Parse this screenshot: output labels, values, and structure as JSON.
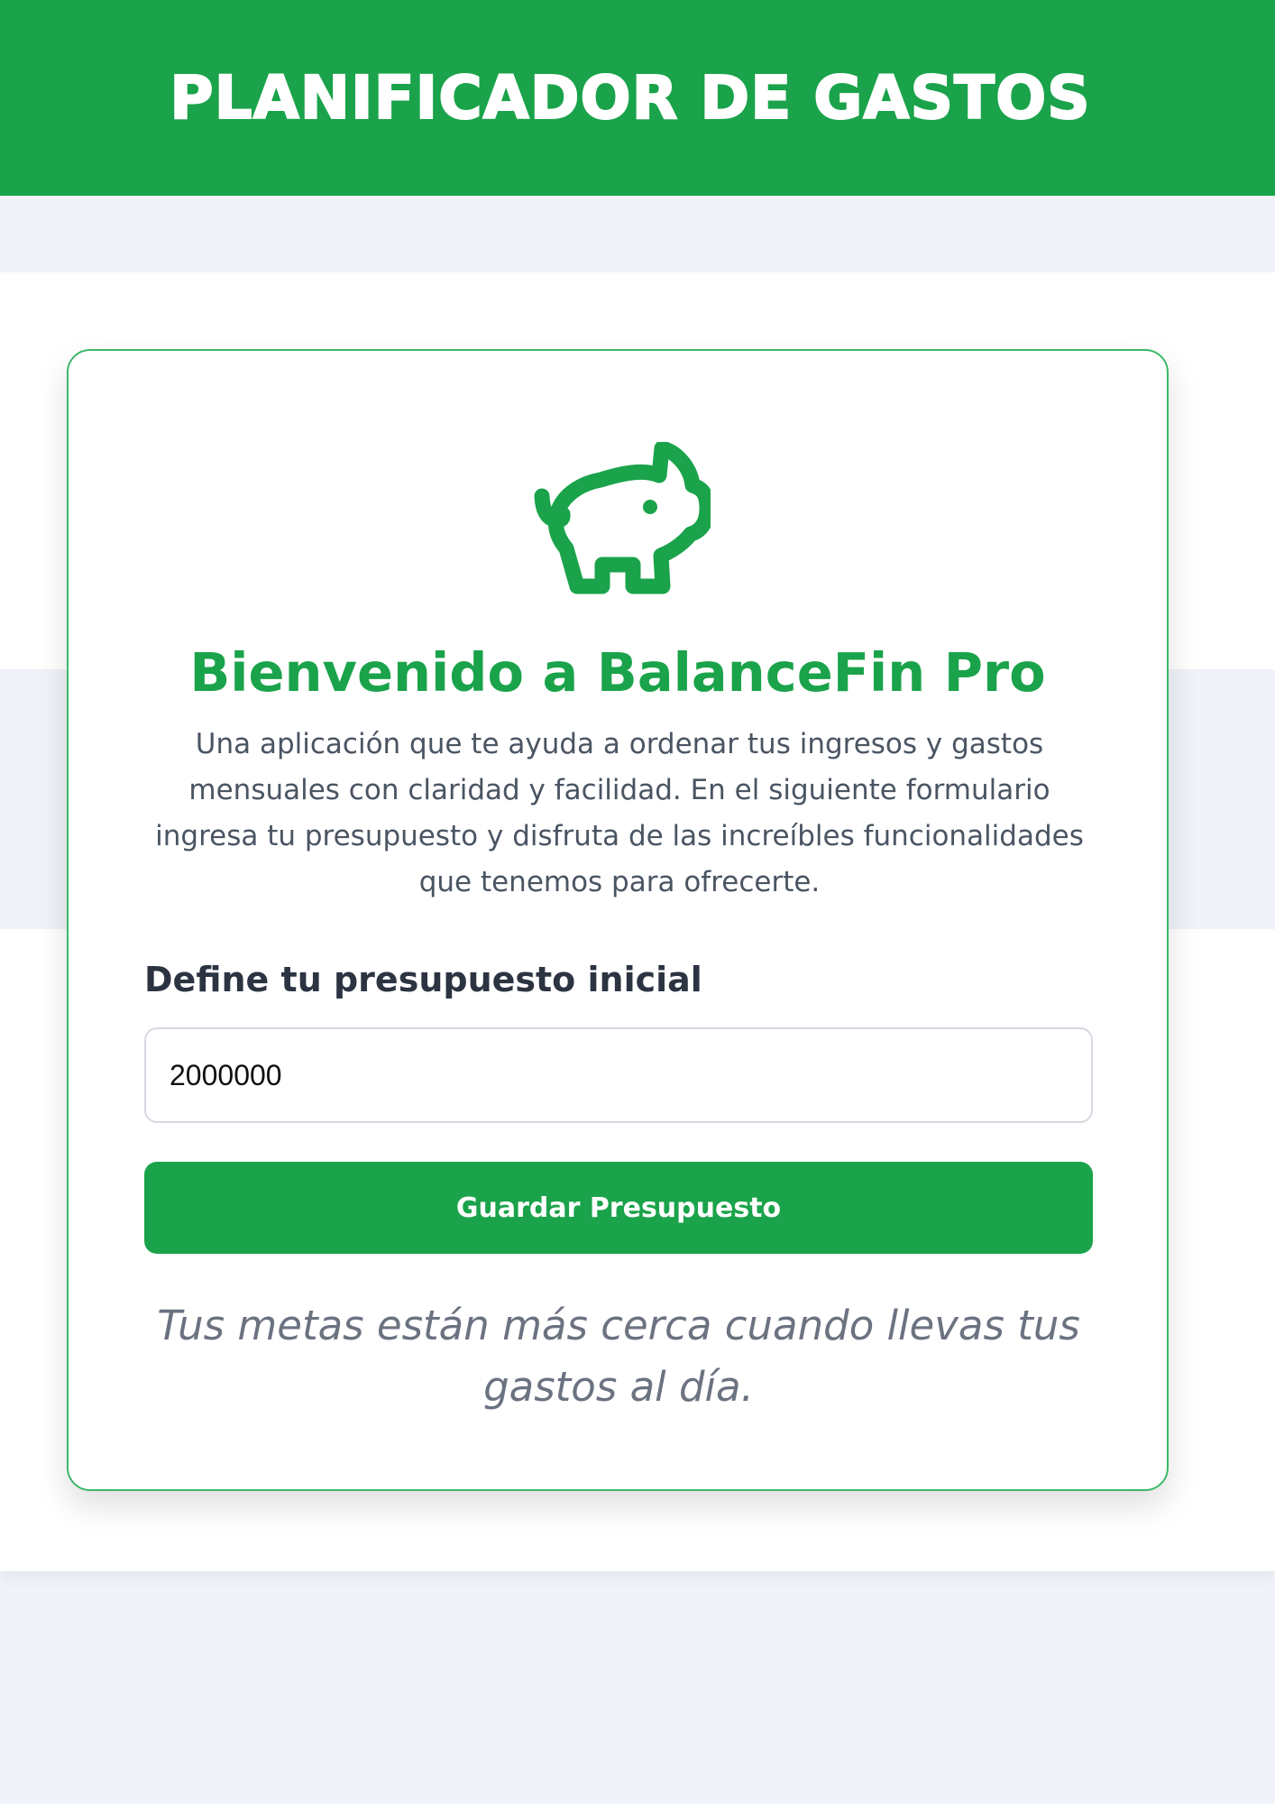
{
  "header": {
    "title": "PLANIFICADOR DE GASTOS"
  },
  "welcome": {
    "icon": "piggy-bank-icon",
    "title": "Bienvenido a BalanceFin Pro",
    "description": "Una aplicación que te ayuda a ordenar tus ingresos y gastos mensuales con claridad y facilidad. En el siguiente formulario ingresa tu presupuesto y disfruta de las increíbles funcionalidades que tenemos para ofrecerte."
  },
  "form": {
    "label": "Define tu presupuesto inicial",
    "budget_value": "2000000",
    "save_label": "Guardar Presupuesto"
  },
  "motto": "Tus metas están más cerca cuando llevas tus gastos al día.",
  "colors": {
    "brand": "#1aa34a",
    "background": "#f0f3f8",
    "card_border": "#3cb86a"
  }
}
